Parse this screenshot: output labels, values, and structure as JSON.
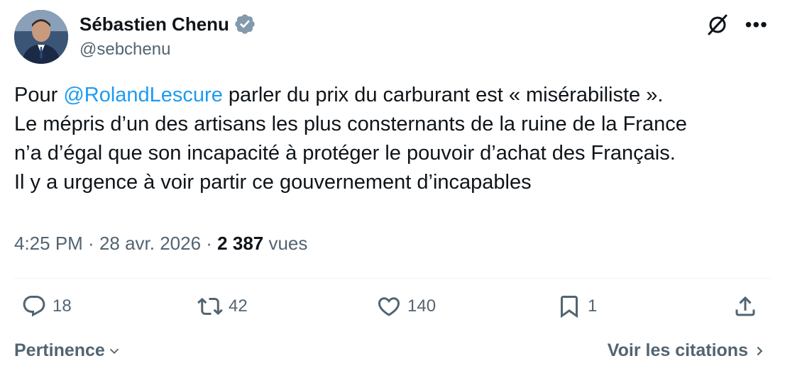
{
  "author": {
    "name": "Sébastien Chenu",
    "handle": "@sebchenu",
    "verified_color": "#829aab"
  },
  "tweet": {
    "line1_before": "Pour ",
    "mention": "@RolandLescure",
    "line1_after": " parler du prix du carburant est « misérabiliste ».",
    "line2": "Le mépris d’un des artisans les plus consternants de la ruine de la France",
    "line3": "n’a d’égal que son incapacité à protéger le pouvoir d’achat des Français.",
    "line4": "Il y a urgence à voir partir ce gouvernement d’incapables"
  },
  "meta": {
    "time": "4:25 PM",
    "separator": " · ",
    "date": "28 avr. 2026",
    "views_count": "2 387",
    "views_label": " vues"
  },
  "actions": {
    "replies": "18",
    "reposts": "42",
    "likes": "140",
    "bookmarks": "1"
  },
  "footer": {
    "sort_label": "Pertinence",
    "quotes_label": "Voir les citations"
  },
  "colors": {
    "accent": "#1d9bf0",
    "muted": "#536471",
    "text": "#0f1419"
  },
  "icons": [
    "grok-icon",
    "more-icon",
    "reply-icon",
    "repost-icon",
    "like-icon",
    "bookmark-icon",
    "share-icon",
    "chevron-down-icon",
    "chevron-right-icon",
    "verified-badge-icon"
  ]
}
